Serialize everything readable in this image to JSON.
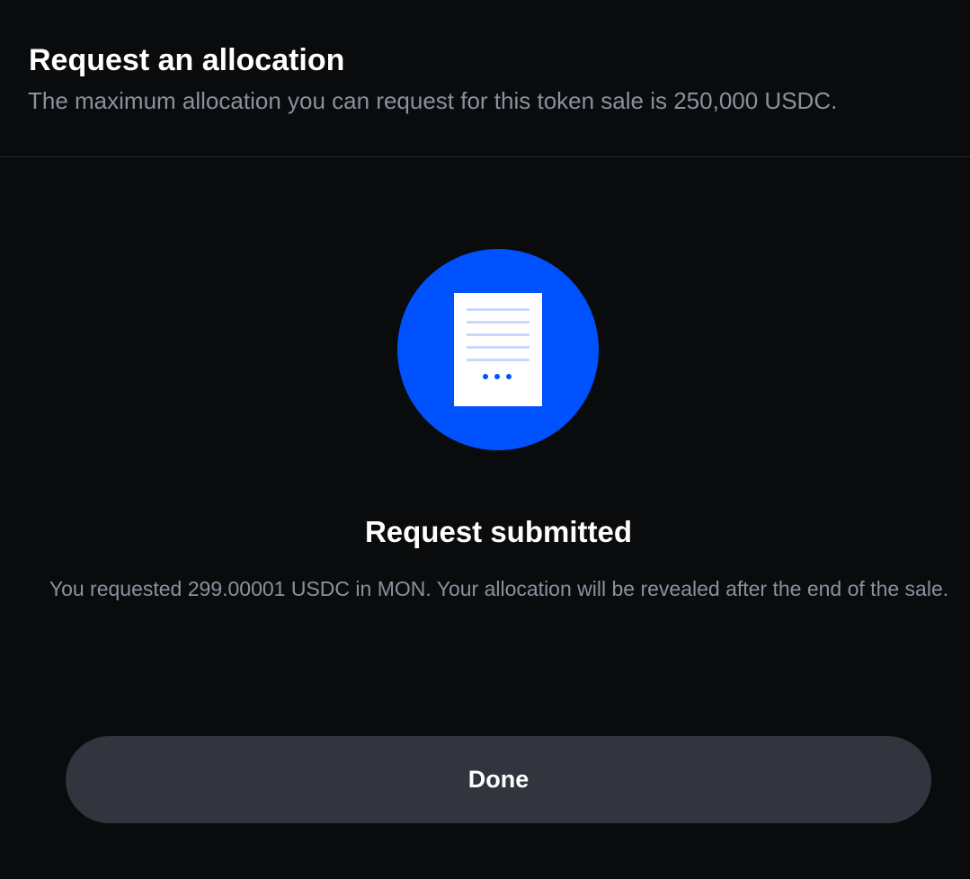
{
  "header": {
    "title": "Request an allocation",
    "subtitle": "The maximum allocation you can request for this token sale is 250,000 USDC."
  },
  "illustration": {
    "icon": "document-icon",
    "circle_color": "#0052ff"
  },
  "status": {
    "title": "Request submitted",
    "body": "You requested 299.00001 USDC in MON. Your allocation will be revealed after the end of the sale."
  },
  "actions": {
    "done_label": "Done"
  },
  "colors": {
    "background": "#0a0b0d",
    "muted_text": "#8a919e",
    "button_bg": "#32353d",
    "accent": "#0052ff"
  }
}
